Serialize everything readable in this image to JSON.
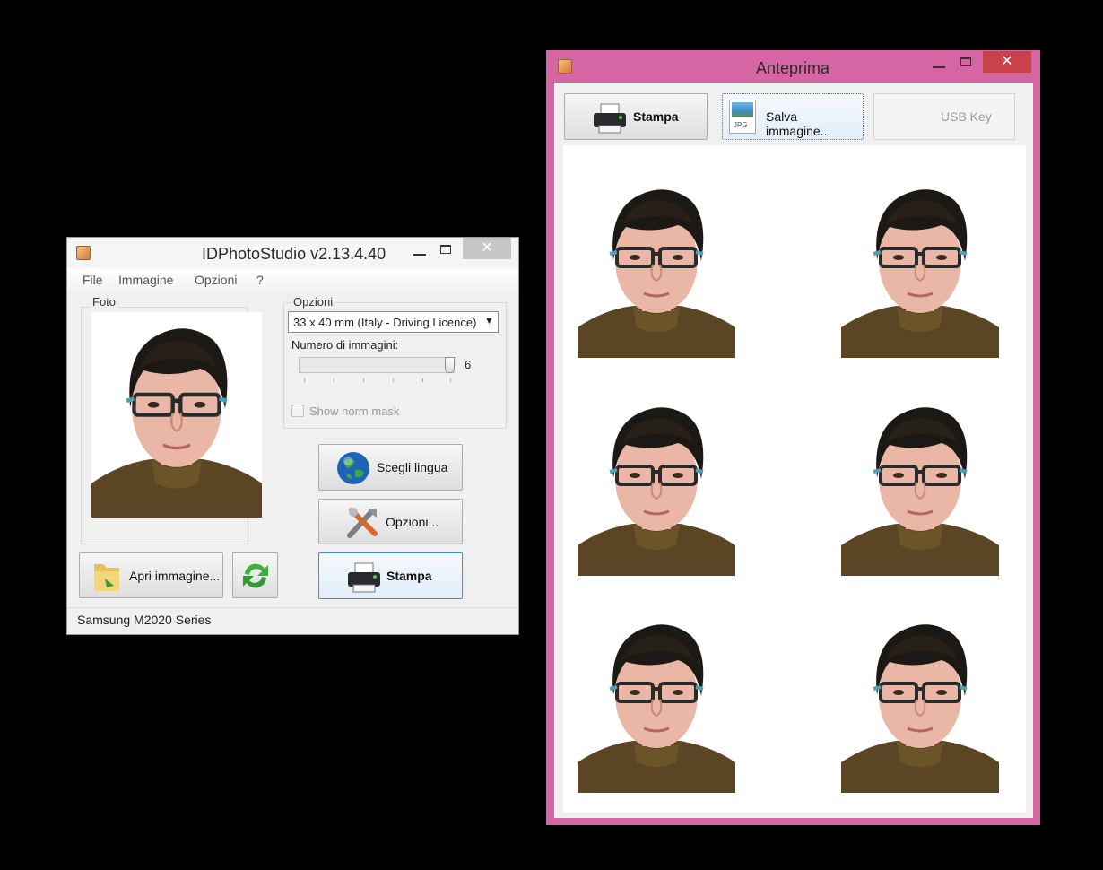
{
  "main_window": {
    "title": "IDPhotoStudio v2.13.4.40",
    "close_glyph": "✕",
    "menu": [
      "File",
      "Immagine",
      "Opzioni",
      "?"
    ],
    "foto_group_label": "Foto",
    "opzioni_group_label": "Opzioni",
    "format_select_value": "33 x 40 mm (Italy - Driving Licence)",
    "numero_label": "Numero di immagini:",
    "slider_value": "6",
    "show_norm_mask_label": "Show norm mask",
    "buttons": {
      "scegli_lingua": "Scegli lingua",
      "opzioni": "Opzioni...",
      "stampa": "Stampa",
      "apri_immagine": "Apri immagine..."
    },
    "status_bar": "Samsung M2020 Series"
  },
  "preview_window": {
    "title": "Anteprima",
    "close_glyph": "✕",
    "buttons": {
      "stampa": "Stampa",
      "salva_immagine": "Salva immagine...",
      "jpg_tag": "JPG",
      "usb_key": "USB Key"
    }
  },
  "icons": {
    "printer": "printer-icon",
    "jpg": "jpg-file-icon",
    "globe": "globe-icon",
    "tools": "tools-icon",
    "folder": "open-folder-icon",
    "refresh": "refresh-icon"
  },
  "colors": {
    "preview_border": "#d565a3",
    "close_button_active": "#c9424a",
    "focus_border": "#3c8fde"
  }
}
